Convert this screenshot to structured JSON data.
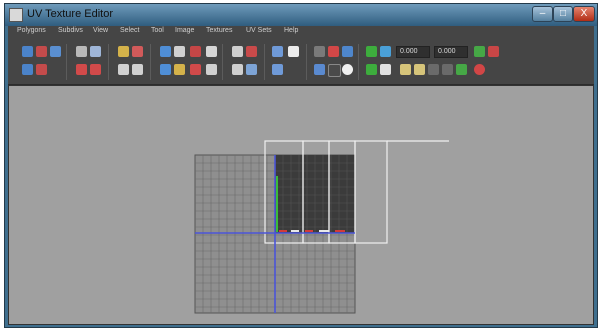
{
  "window": {
    "title": "UV Texture Editor",
    "min_glyph": "–",
    "max_glyph": "□",
    "close_glyph": "X"
  },
  "menu": {
    "items": [
      "Polygons",
      "Subdivs",
      "View",
      "Select",
      "Tool",
      "Image",
      "Textures",
      "UV Sets",
      "Help"
    ]
  },
  "toolbar": {
    "u_value": "0.000",
    "v_value": "0.000"
  },
  "colors": {
    "titlebar": "#4f7fa2",
    "menubar": "#454545",
    "viewport_bg": "#a0a0a0",
    "grid_line": "#5f5f5f",
    "texture_dark": "#3b3b3b",
    "u_axis": "#4b55d8",
    "v_axis": "#4b55d8",
    "uv_highlight": "#3bbb3b",
    "uv_red": "#d23a3a",
    "frame_white": "#f0f0f0"
  }
}
